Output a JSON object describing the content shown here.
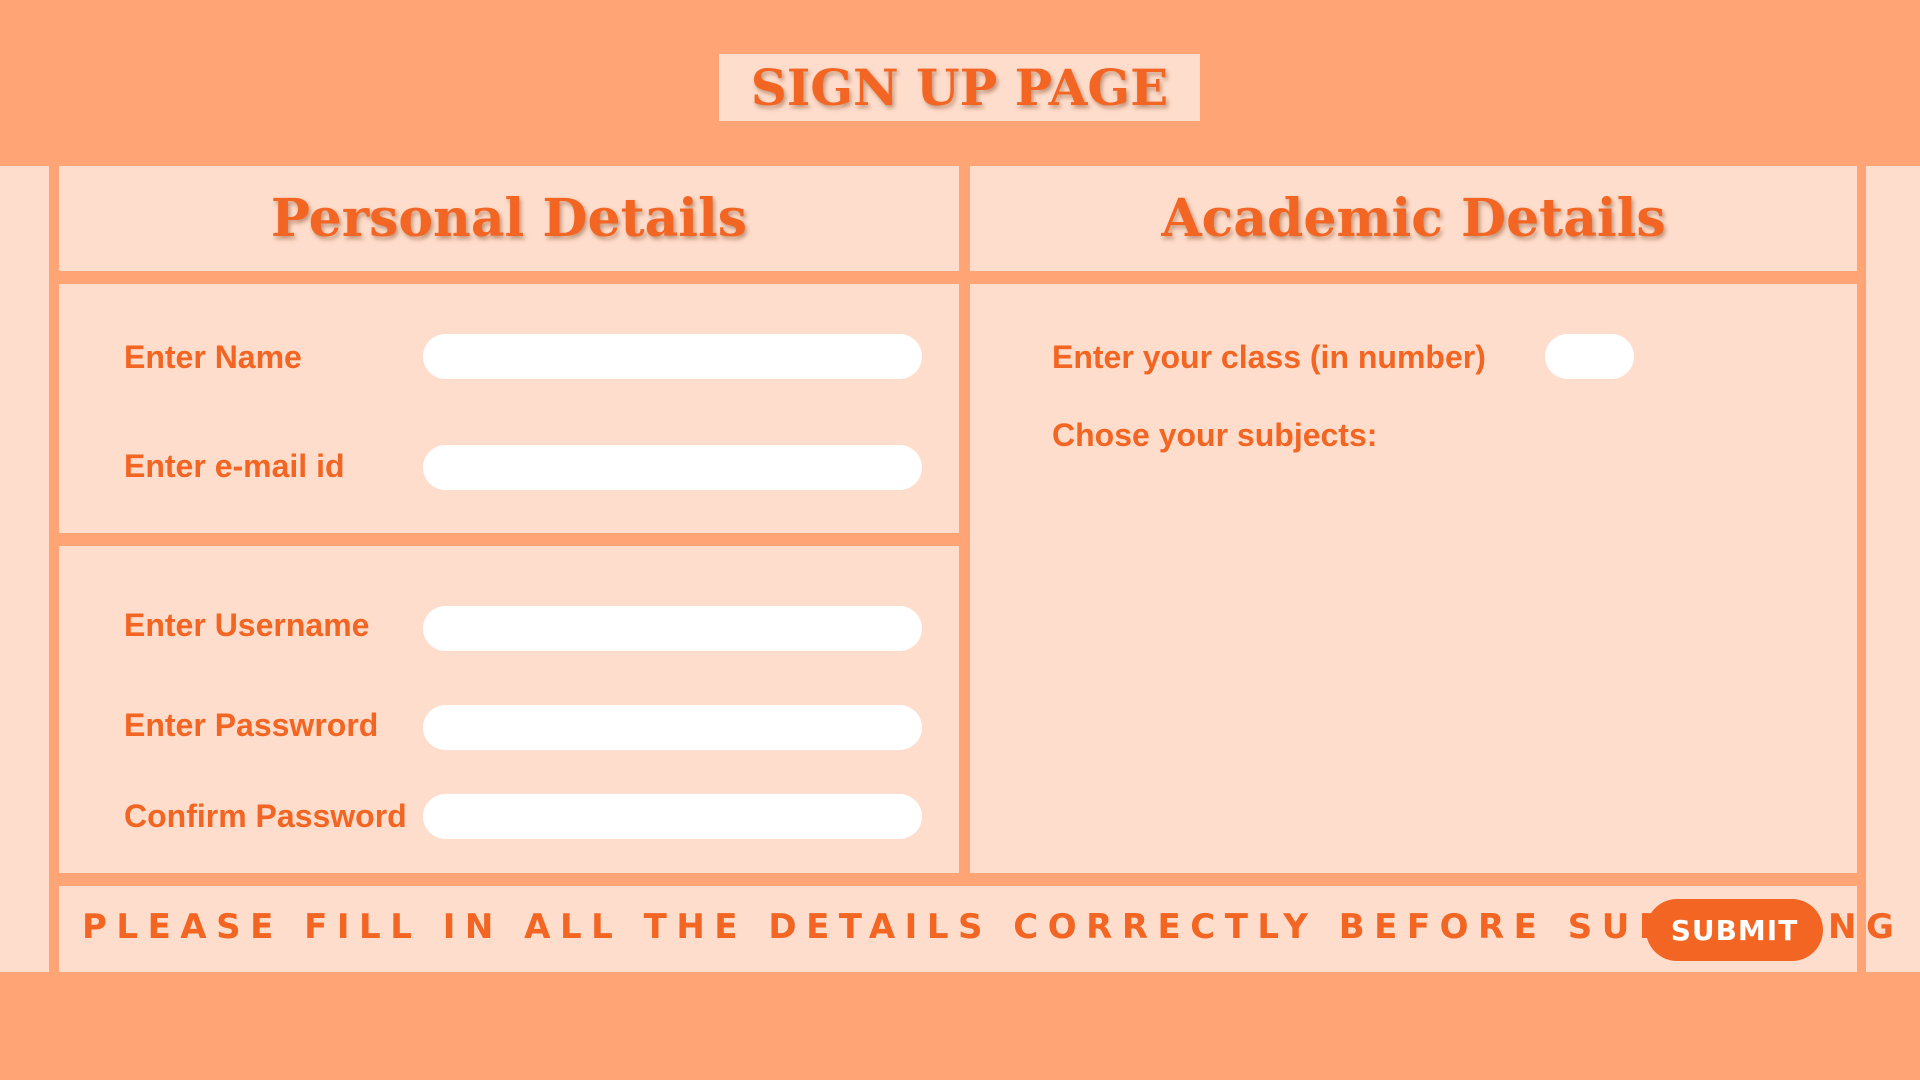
{
  "page_title": "SIGN UP PAGE",
  "personal": {
    "heading": "Personal Details",
    "name_label": "Enter Name",
    "name_value": "",
    "email_label": "Enter e-mail id",
    "email_value": "",
    "username_label": "Enter Username",
    "username_value": "",
    "password_label": "Enter Passwrord",
    "password_value": "",
    "confirm_label": "Confirm Password",
    "confirm_value": ""
  },
  "academic": {
    "heading": "Academic Details",
    "class_label": "Enter your class (in number)",
    "class_value": "",
    "subjects_label": "Chose your subjects:"
  },
  "footer": {
    "notice": "PLEASE FILL IN ALL THE DETAILS CORRECTLY BEFORE SUBMITTING",
    "submit_label": "SUBMIT"
  },
  "colors": {
    "background": "#FFA475",
    "panel": "#FFDDCC",
    "accent": "#F26522",
    "field": "#FFFFFF"
  }
}
